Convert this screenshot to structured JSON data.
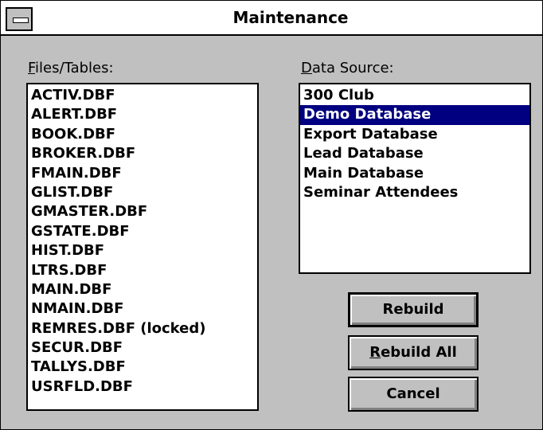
{
  "window": {
    "title": "Maintenance"
  },
  "files": {
    "label": "Files/Tables:",
    "items": [
      "ACTIV.DBF",
      "ALERT.DBF",
      "BOOK.DBF",
      "BROKER.DBF",
      "FMAIN.DBF",
      "GLIST.DBF",
      "GMASTER.DBF",
      "GSTATE.DBF",
      "HIST.DBF",
      "LTRS.DBF",
      "MAIN.DBF",
      "NMAIN.DBF",
      "REMRES.DBF (locked)",
      "SECUR.DBF",
      "TALLYS.DBF",
      "USRFLD.DBF"
    ]
  },
  "data_source": {
    "label": "Data Source:",
    "items": [
      "300 Club",
      "Demo Database",
      "Export Database",
      "Lead Database",
      "Main Database",
      "Seminar Attendees"
    ],
    "selected": "Demo Database"
  },
  "buttons": {
    "rebuild": "Rebuild",
    "rebuild_all": "Rebuild All",
    "cancel": "Cancel"
  },
  "colors": {
    "selection": "#000080",
    "face": "#c0c0c0"
  }
}
